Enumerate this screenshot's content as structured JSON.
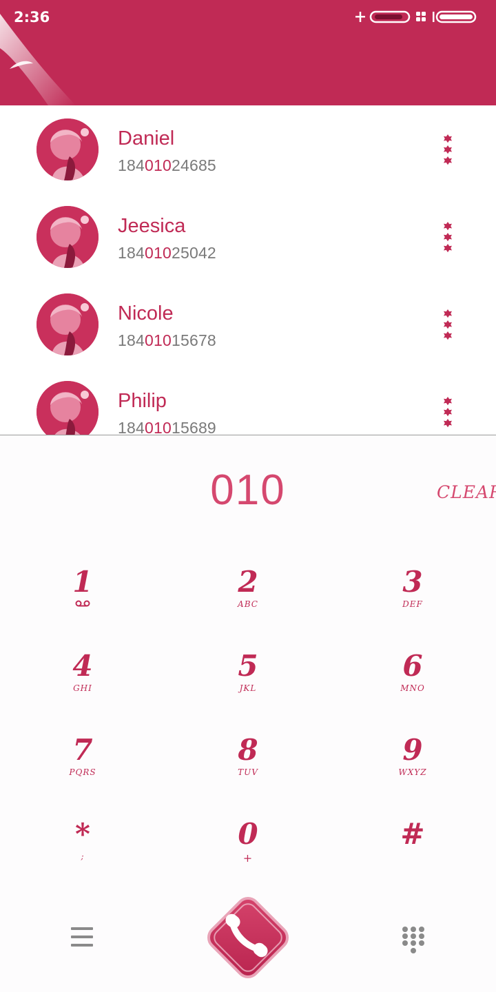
{
  "status_bar": {
    "time": "2:36"
  },
  "contacts": [
    {
      "name": "Daniel",
      "number_pre": "184",
      "number_match": "010",
      "number_post": "24685"
    },
    {
      "name": "Jeesica",
      "number_pre": "184",
      "number_match": "010",
      "number_post": "25042"
    },
    {
      "name": "Nicole",
      "number_pre": "184",
      "number_match": "010",
      "number_post": "15678"
    },
    {
      "name": "Philip",
      "number_pre": "184",
      "number_match": "010",
      "number_post": "15689"
    }
  ],
  "dialer": {
    "input_value": "010",
    "clear_label": "CLEAR",
    "keys": [
      {
        "digit": "1",
        "letters": ""
      },
      {
        "digit": "2",
        "letters": "ABC"
      },
      {
        "digit": "3",
        "letters": "DEF"
      },
      {
        "digit": "4",
        "letters": "GHI"
      },
      {
        "digit": "5",
        "letters": "JKL"
      },
      {
        "digit": "6",
        "letters": "MNO"
      },
      {
        "digit": "7",
        "letters": "PQRS"
      },
      {
        "digit": "8",
        "letters": "TUV"
      },
      {
        "digit": "9",
        "letters": "WXYZ"
      },
      {
        "digit": "*",
        "letters": ";"
      },
      {
        "digit": "0",
        "letters": "+"
      },
      {
        "digit": "#",
        "letters": ""
      }
    ]
  },
  "icons": {
    "voicemail": "voicemail-icon",
    "menu": "hamburger-menu-icon",
    "call": "phone-call-icon",
    "dialpad": "dialpad-icon",
    "more": "more-vertical-icon"
  },
  "colors": {
    "accent": "#c02a55",
    "accent_light": "#d5486f",
    "secondary_text": "#7a7a7a"
  }
}
